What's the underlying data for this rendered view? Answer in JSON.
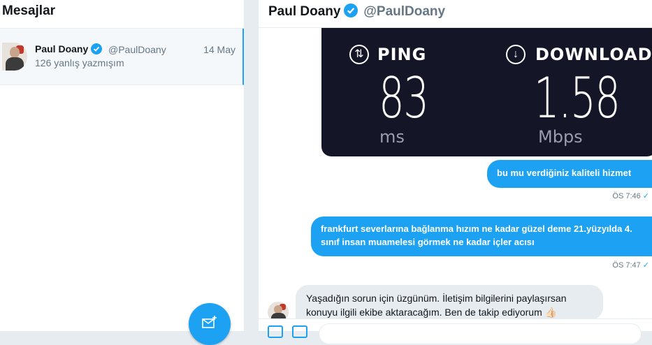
{
  "sidebar": {
    "title": "Mesajlar",
    "conversation": {
      "name": "Paul Doany",
      "handle": "@PaulDoany",
      "date": "14 May",
      "preview": "126 yanlış yazmışım"
    },
    "fab_icon": "new-message-icon"
  },
  "chat": {
    "header": {
      "name": "Paul Doany",
      "handle": "@PaulDoany"
    },
    "speedtest": {
      "ping_label": "PING",
      "ping_value": "83",
      "ping_unit": "ms",
      "download_label": "DOWNLOAD",
      "download_value": "1.58",
      "download_unit": "Mbps"
    },
    "messages": [
      {
        "text": "bu mu verdiğiniz kaliteli hizmet",
        "time": "ÖS 7:46"
      },
      {
        "text": "frankfurt severlarına bağlanma hızım ne kadar güzel deme 21.yüzyılda 4. sınıf insan muamelesi görmek ne kadar içler acısı",
        "time": "ÖS 7:47"
      },
      {
        "text": "Yaşadığın sorun için üzgünüm. İletişim bilgilerini paylaşırsan konuyu ilgili ekibe aktaracağım. Ben de takip ediyorum 👍🏻"
      }
    ]
  },
  "colors": {
    "accent": "#1da1f2",
    "speedtest_bg": "#141526",
    "incoming_bubble": "#e6ecf0"
  }
}
